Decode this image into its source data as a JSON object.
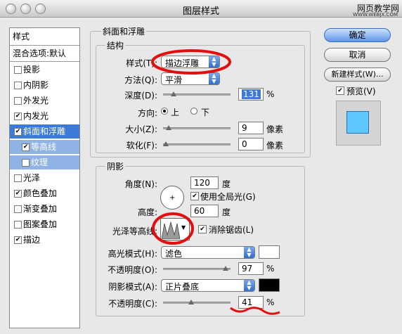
{
  "window": {
    "title": "图层样式",
    "watermark": "网页教学网",
    "watermark_url": "WWW.WEBJX.COM"
  },
  "sidebar": {
    "header": "样式",
    "blend": "混合选项:默认",
    "items": [
      {
        "label": "投影",
        "checked": false
      },
      {
        "label": "内阴影",
        "checked": false
      },
      {
        "label": "外发光",
        "checked": false
      },
      {
        "label": "内发光",
        "checked": true
      },
      {
        "label": "斜面和浮雕",
        "checked": true
      },
      {
        "label": "等高线",
        "checked": true
      },
      {
        "label": "纹理",
        "checked": false
      },
      {
        "label": "光泽",
        "checked": false
      },
      {
        "label": "颜色叠加",
        "checked": true
      },
      {
        "label": "渐变叠加",
        "checked": false
      },
      {
        "label": "图案叠加",
        "checked": false
      },
      {
        "label": "描边",
        "checked": true
      }
    ]
  },
  "bevel": {
    "section_title": "斜面和浮雕",
    "structure_title": "结构",
    "style_label": "样式(T):",
    "style_value": "描边浮雕",
    "technique_label": "方法(Q):",
    "technique_value": "平滑",
    "depth_label": "深度(D):",
    "depth_value": "131",
    "depth_unit": "%",
    "depth_slider": 0.13,
    "direction_label": "方向:",
    "dir_up": "上",
    "dir_down": "下",
    "size_label": "大小(Z):",
    "size_value": "9",
    "size_unit": "像素",
    "size_slider": 0.05,
    "soften_label": "软化(F):",
    "soften_value": "0",
    "soften_unit": "像素",
    "soften_slider": 0.0
  },
  "shading": {
    "title": "阴影",
    "angle_label": "角度(N):",
    "angle_value": "120",
    "angle_unit": "度",
    "global_light": "使用全局光(G)",
    "altitude_label": "高度:",
    "altitude_value": "60",
    "altitude_unit": "度",
    "gloss_label": "光泽等高线:",
    "antialias": "消除锯齿(L)",
    "highlight_mode_label": "高光模式(H):",
    "highlight_mode_value": "滤色",
    "highlight_color": "#ffffff",
    "highlight_opacity_label": "不透明度(O):",
    "highlight_opacity_value": "97",
    "highlight_opacity_unit": "%",
    "highlight_opacity_slider": 0.97,
    "shadow_mode_label": "阴影模式(A):",
    "shadow_mode_value": "正片叠底",
    "shadow_color": "#000000",
    "shadow_opacity_label": "不透明度(C):",
    "shadow_opacity_value": "41",
    "shadow_opacity_unit": "%",
    "shadow_opacity_slider": 0.41
  },
  "buttons": {
    "ok": "确定",
    "cancel": "取消",
    "new_style": "新建样式(W)...",
    "preview": "预览(V)"
  },
  "colors": {
    "accent": "#3d79d7",
    "annotation": "#e01010",
    "preview_fill": "#5cc8ff"
  }
}
